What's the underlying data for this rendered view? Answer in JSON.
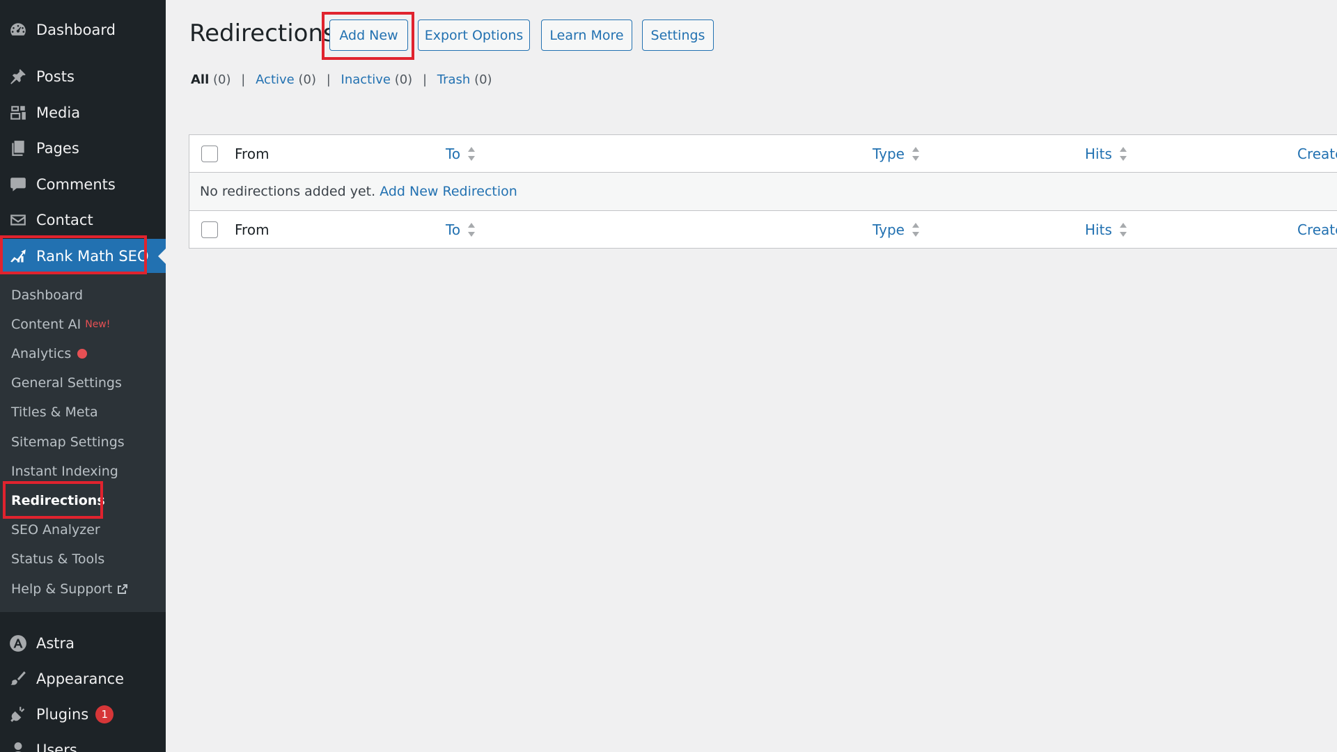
{
  "sidebar": {
    "top_items": [
      {
        "label": "Dashboard",
        "icon": "dashboard-icon"
      },
      {
        "label": "Posts",
        "icon": "pushpin-icon"
      },
      {
        "label": "Media",
        "icon": "media-icon"
      },
      {
        "label": "Pages",
        "icon": "pages-icon"
      },
      {
        "label": "Comments",
        "icon": "comment-icon"
      },
      {
        "label": "Contact",
        "icon": "envelope-icon"
      },
      {
        "label": "Rank Math SEO",
        "icon": "rank-math-icon"
      }
    ],
    "submenu": [
      {
        "label": "Dashboard"
      },
      {
        "label": "Content AI",
        "tag": "New!"
      },
      {
        "label": "Analytics"
      },
      {
        "label": "General Settings"
      },
      {
        "label": "Titles & Meta"
      },
      {
        "label": "Sitemap Settings"
      },
      {
        "label": "Instant Indexing"
      },
      {
        "label": "Redirections"
      },
      {
        "label": "SEO Analyzer"
      },
      {
        "label": "Status & Tools"
      },
      {
        "label": "Help & Support"
      }
    ],
    "bottom_items": [
      {
        "label": "Astra",
        "icon": "astra-icon"
      },
      {
        "label": "Appearance",
        "icon": "paintbrush-icon"
      },
      {
        "label": "Plugins",
        "icon": "plug-icon",
        "badge": "1"
      },
      {
        "label": "Users",
        "icon": "user-icon"
      }
    ]
  },
  "header": {
    "title": "Redirections",
    "actions": [
      "Add New",
      "Export Options",
      "Learn More",
      "Settings"
    ]
  },
  "filters": [
    {
      "label": "All",
      "count": "(0)"
    },
    {
      "label": "Active",
      "count": "(0)"
    },
    {
      "label": "Inactive",
      "count": "(0)"
    },
    {
      "label": "Trash",
      "count": "(0)"
    }
  ],
  "table": {
    "columns": [
      "From",
      "To",
      "Type",
      "Hits",
      "Created"
    ],
    "empty_text": "No redirections added yet.",
    "empty_link": "Add New Redirection"
  },
  "colors": {
    "sidebar_bg": "#1d2327",
    "submenu_bg": "#2c3338",
    "accent": "#2271b1",
    "highlight": "#e0232e",
    "badge": "#d63638"
  }
}
